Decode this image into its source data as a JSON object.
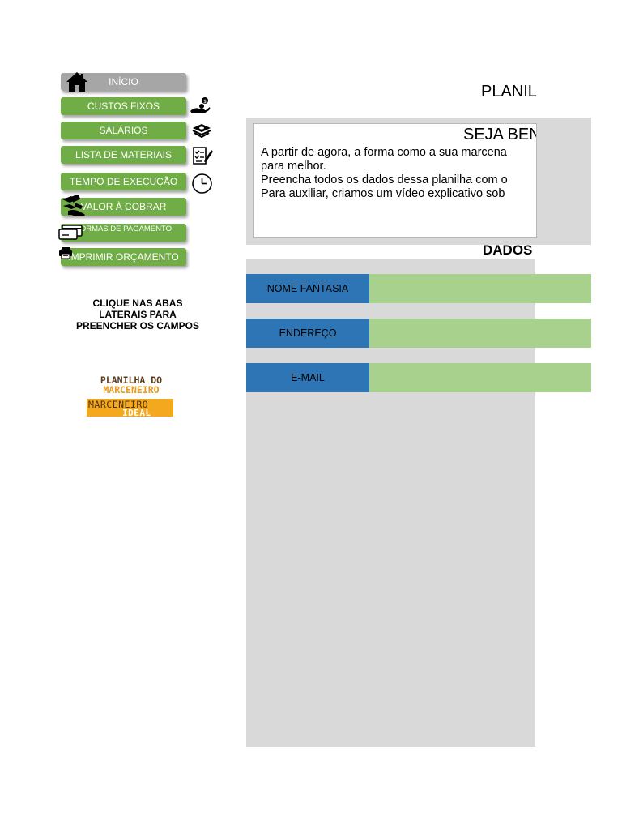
{
  "nav": {
    "inicio": "INÍCIO",
    "custos_fixos": "CUSTOS FIXOS",
    "salarios": "SALÁRIOS",
    "lista_materiais": "LISTA DE MATERIAIS",
    "tempo_execucao": "TEMPO DE EXECUÇÃO",
    "valor_cobrar": "VALOR À COBRAR",
    "formas_pagamento": "FORMAS DE PAGAMENTO",
    "imprimir_orcamento": "IMPRIMIR ORÇAMENTO"
  },
  "hint": {
    "line1": "CLIQUE NAS ABAS",
    "line2": "LATERAIS PARA",
    "line3": "PREENCHER OS CAMPOS"
  },
  "logo": {
    "line1": "PLANILHA DO",
    "line2": "MARCENEIRO",
    "line3": "MARCENEIRO",
    "line4": "IDEAL"
  },
  "header": {
    "title": "PLANIL"
  },
  "welcome": {
    "title": "SEJA BEN",
    "lines": [
      "A partir de agora, a forma como a sua marcena",
      "para melhor.",
      "Preencha todos os dados dessa planilha com o",
      "Para auxiliar, criamos um vídeo explicativo sob"
    ]
  },
  "section": {
    "title": "DADOS"
  },
  "fields": {
    "nome_fantasia": {
      "label": "NOME FANTASIA",
      "value": ""
    },
    "endereco": {
      "label": "ENDEREÇO",
      "value": ""
    },
    "email": {
      "label": "E-MAIL",
      "value": ""
    }
  },
  "colors": {
    "nav_green": "#70ad47",
    "nav_home": "#a6a6a6",
    "label_blue": "#2e75b6",
    "input_green": "#a9d18e",
    "panel_gray": "#d9d9d9",
    "logo_orange": "#f4a81d"
  },
  "icons": [
    "home-icon",
    "money-hand-icon",
    "cash-stack-icon",
    "checklist-icon",
    "clock-icon",
    "payment-hand-icon",
    "credit-card-icon",
    "printer-icon"
  ]
}
